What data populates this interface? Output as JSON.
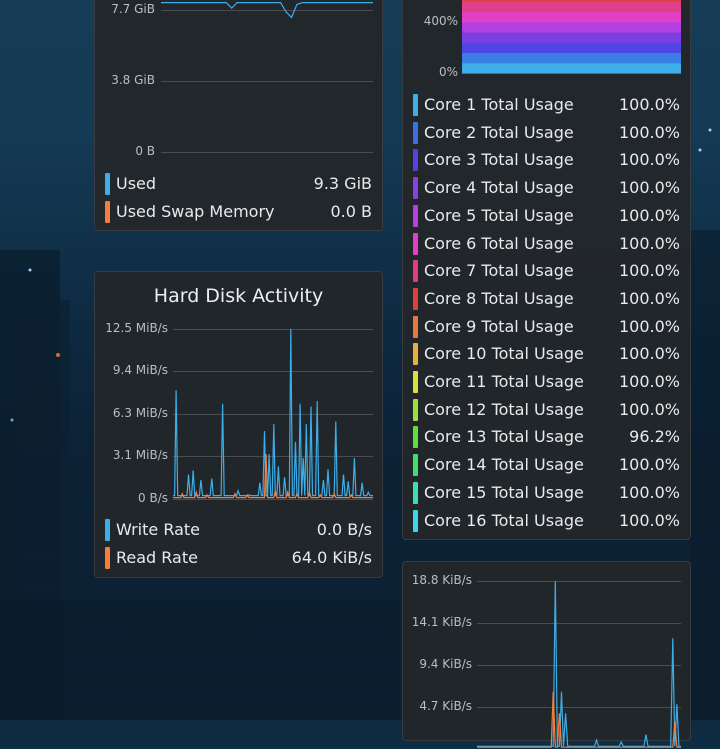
{
  "colors": {
    "used": "#3daee9",
    "swap": "#f67e3b",
    "write": "#3daee9",
    "read": "#f67e3b"
  },
  "memory_widget": {
    "chart_data": {
      "type": "line",
      "ytick_labels": [
        "7.7 GiB",
        "3.8 GiB",
        "0 B"
      ],
      "y_values": [
        7.7,
        3.8,
        0
      ],
      "ylim": [
        0,
        7.7
      ],
      "series": [
        {
          "name": "Used",
          "values": [
            8.1,
            8.1,
            8.1,
            8.1,
            8.1,
            8.1,
            8.1,
            8.1,
            8.1,
            8.1,
            8.1,
            8.1,
            8.1,
            7.8,
            8.1,
            8.1,
            8.1,
            8.1,
            8.1,
            8.1,
            8.1,
            8.1,
            8.1,
            7.6,
            7.3,
            8.0,
            8.1,
            8.1,
            8.1,
            8.1,
            8.1,
            8.1,
            8.1,
            8.1,
            8.1,
            8.1,
            8.1,
            8.1,
            8.1,
            8.1
          ]
        }
      ]
    },
    "legend": [
      {
        "label": "Used",
        "value": "9.3 GiB",
        "color": "#3daee9"
      },
      {
        "label": "Used Swap Memory",
        "value": "0.0 B",
        "color": "#f67e3b"
      }
    ]
  },
  "disk_widget": {
    "title": "Hard Disk Activity",
    "chart_data": {
      "type": "line",
      "title": "Hard Disk Activity",
      "ytick_labels": [
        "12.5 MiB/s",
        "9.4 MiB/s",
        "6.3 MiB/s",
        "3.1 MiB/s",
        "0 B/s"
      ],
      "y_values": [
        12.5,
        9.4,
        6.3,
        3.1,
        0
      ],
      "ylim": [
        0,
        12.5
      ],
      "x_count": 130,
      "series": [
        {
          "name": "Write Rate",
          "color": "#3daee9",
          "baseline": 0.25,
          "spikes": [
            [
              2,
              8.0
            ],
            [
              10,
              1.8
            ],
            [
              13,
              2.1
            ],
            [
              18,
              1.4
            ],
            [
              25,
              1.5
            ],
            [
              32,
              7.0
            ],
            [
              42,
              0.6
            ],
            [
              49,
              0.3
            ],
            [
              56,
              1.2
            ],
            [
              59,
              5.0
            ],
            [
              62,
              3.3
            ],
            [
              65,
              5.5
            ],
            [
              68,
              2.4
            ],
            [
              72,
              1.6
            ],
            [
              76,
              12.5
            ],
            [
              79,
              4.2
            ],
            [
              82,
              7.0
            ],
            [
              84,
              3.0
            ],
            [
              86,
              5.5
            ],
            [
              89,
              6.8
            ],
            [
              93,
              7.2
            ],
            [
              97,
              1.4
            ],
            [
              100,
              2.2
            ],
            [
              105,
              5.7
            ],
            [
              110,
              1.8
            ],
            [
              113,
              1.3
            ],
            [
              117,
              3.0
            ],
            [
              122,
              1.2
            ],
            [
              126,
              0.5
            ]
          ]
        },
        {
          "name": "Read Rate",
          "color": "#f67e3b",
          "baseline": 0.1,
          "spikes": [
            [
              6,
              0.4
            ],
            [
              15,
              0.5
            ],
            [
              22,
              0.3
            ],
            [
              40,
              0.4
            ],
            [
              48,
              0.3
            ],
            [
              60,
              3.3
            ],
            [
              66,
              0.6
            ],
            [
              74,
              0.5
            ],
            [
              80,
              0.4
            ],
            [
              88,
              0.5
            ],
            [
              95,
              0.3
            ],
            [
              104,
              0.4
            ],
            [
              115,
              0.3
            ]
          ]
        }
      ]
    },
    "legend": [
      {
        "label": "Write Rate",
        "value": "0.0 B/s",
        "color": "#3daee9"
      },
      {
        "label": "Read Rate",
        "value": "64.0 KiB/s",
        "color": "#f67e3b"
      }
    ]
  },
  "cpu_widget": {
    "chart_data": {
      "type": "area",
      "ytick_labels": [
        "400%",
        "0%"
      ],
      "y_values": [
        400,
        0
      ],
      "band_colors": [
        "#3daee9",
        "#3a7ee6",
        "#4f44e6",
        "#7a3fe0",
        "#b23fe0",
        "#e03fc8",
        "#e0408a",
        "#e04040"
      ]
    },
    "legend": [
      {
        "label": "Core 1 Total Usage",
        "value": "100.0%",
        "color": "#3daee9"
      },
      {
        "label": "Core 2 Total Usage",
        "value": "100.0%",
        "color": "#3a6fe8"
      },
      {
        "label": "Core 3 Total Usage",
        "value": "100.0%",
        "color": "#5a3fe6"
      },
      {
        "label": "Core 4 Total Usage",
        "value": "100.0%",
        "color": "#8a3fe0"
      },
      {
        "label": "Core 5 Total Usage",
        "value": "100.0%",
        "color": "#b83fe0"
      },
      {
        "label": "Core 6 Total Usage",
        "value": "100.0%",
        "color": "#e03fc8"
      },
      {
        "label": "Core 7 Total Usage",
        "value": "100.0%",
        "color": "#e03f7a"
      },
      {
        "label": "Core 8 Total Usage",
        "value": "100.0%",
        "color": "#e03f3f"
      },
      {
        "label": "Core 9 Total Usage",
        "value": "100.0%",
        "color": "#e8783c"
      },
      {
        "label": "Core 10 Total Usage",
        "value": "100.0%",
        "color": "#e8b03c"
      },
      {
        "label": "Core 11 Total Usage",
        "value": "100.0%",
        "color": "#d8e03c"
      },
      {
        "label": "Core 12 Total Usage",
        "value": "100.0%",
        "color": "#9ee03c"
      },
      {
        "label": "Core 13 Total Usage",
        "value": "96.2%",
        "color": "#5de03c"
      },
      {
        "label": "Core 14 Total Usage",
        "value": "100.0%",
        "color": "#3ce06a"
      },
      {
        "label": "Core 15 Total Usage",
        "value": "100.0%",
        "color": "#3ce0b0"
      },
      {
        "label": "Core 16 Total Usage",
        "value": "100.0%",
        "color": "#3cd8e8"
      }
    ]
  },
  "network_widget": {
    "chart_data": {
      "type": "line",
      "ytick_labels": [
        "18.8 KiB/s",
        "14.1 KiB/s",
        "9.4 KiB/s",
        "4.7 KiB/s"
      ],
      "y_values": [
        18.8,
        14.1,
        9.4,
        4.7
      ],
      "ylim": [
        0,
        18.8
      ],
      "x_count": 100,
      "series": [
        {
          "color": "#3daee9",
          "baseline": 0.3,
          "spikes": [
            [
              38,
              18.8
            ],
            [
              41,
              6.4
            ],
            [
              43,
              4.0
            ],
            [
              58,
              1.0
            ],
            [
              70,
              0.8
            ],
            [
              82,
              1.6
            ],
            [
              95,
              12.4
            ],
            [
              97,
              5.0
            ]
          ]
        },
        {
          "color": "#f67e3b",
          "baseline": 0.2,
          "spikes": [
            [
              37,
              6.4
            ],
            [
              40,
              4.0
            ],
            [
              96,
              3.0
            ]
          ]
        }
      ]
    }
  }
}
